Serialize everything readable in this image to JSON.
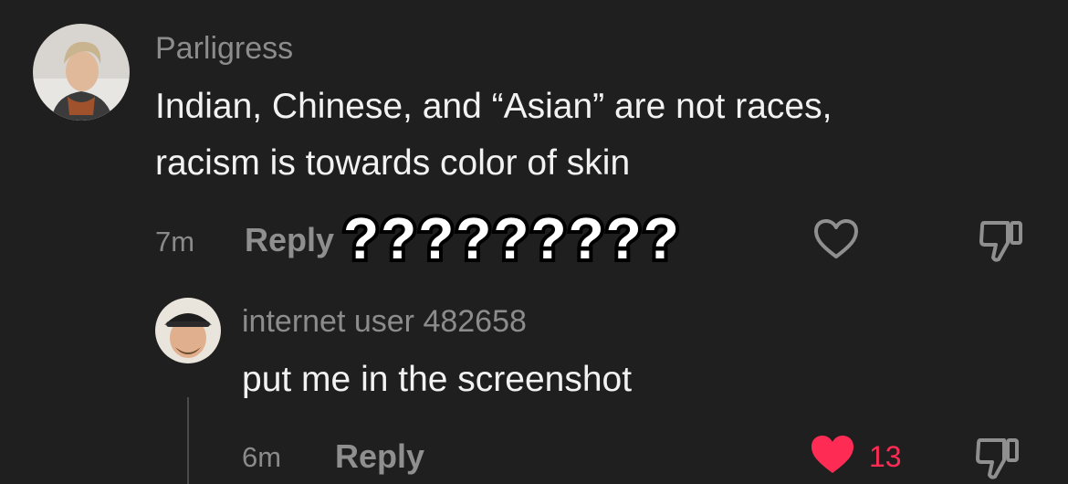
{
  "comment": {
    "username": "Parligress",
    "text_line1": "Indian, Chinese, and “Asian” are not races,",
    "text_line2": "racism is towards color of skin",
    "timestamp": "7m",
    "reply_label": "Reply",
    "like_icon": "heart-outline-icon",
    "dislike_icon": "thumbs-down-icon"
  },
  "overlay": {
    "text": "?????????"
  },
  "reply": {
    "username": "internet user 482658",
    "text": "put me in the screenshot",
    "timestamp": "6m",
    "reply_label": "Reply",
    "like_icon": "heart-filled-icon",
    "like_count": "13",
    "dislike_icon": "thumbs-down-icon"
  },
  "colors": {
    "background": "#1f1f1f",
    "liked_heart": "#fe2c55",
    "muted_text": "#8c8c8c",
    "body_text": "#f2f2f2"
  }
}
